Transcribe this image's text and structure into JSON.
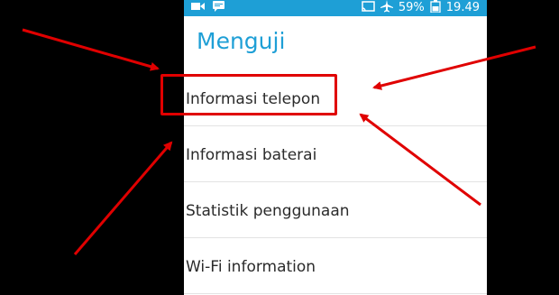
{
  "status_bar": {
    "battery_percent": "59%",
    "time": "19.49",
    "icons": [
      "video-camera-icon",
      "chat-message-icon",
      "cast-icon",
      "airplane-mode-icon",
      "battery-icon"
    ],
    "color": "#1e9fd6"
  },
  "screen": {
    "title": "Menguji",
    "accent_color": "#1e9fd6"
  },
  "menu": {
    "items": [
      {
        "label": "Informasi telepon"
      },
      {
        "label": "Informasi baterai"
      },
      {
        "label": "Statistik penggunaan"
      },
      {
        "label": "Wi-Fi information"
      }
    ]
  },
  "annotations": {
    "highlight_color": "#e00000",
    "highlighted_item": "Informasi telepon",
    "arrow_count": 4
  }
}
